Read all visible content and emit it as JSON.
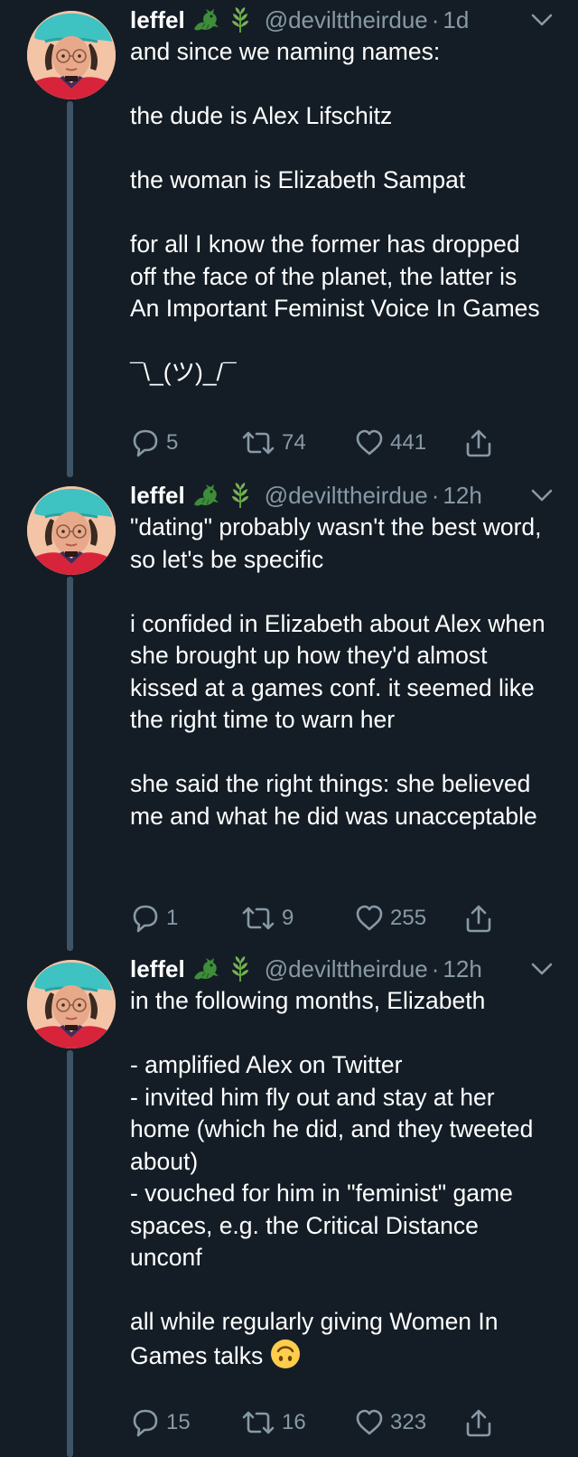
{
  "tweets": [
    {
      "name": "leffel",
      "handle": "@devilttheirdue",
      "time": "1d",
      "text": "and since we naming names:\n\nthe dude is Alex Lifschitz\n\nthe woman is Elizabeth Sampat\n\nfor all I know the former has dropped off the face of the planet, the latter is An Important Feminist Voice In Games\n\n¯\\_(ツ)_/¯",
      "replies": "5",
      "retweets": "74",
      "likes": "441"
    },
    {
      "name": "leffel",
      "handle": "@devilttheirdue",
      "time": "12h",
      "text": "\"dating\" probably wasn't the best word, so let's be specific\n\ni confided in Elizabeth about Alex when she brought up how they'd almost kissed at a games conf. it seemed like the right time to warn her\n\nshe said the right things: she believed me and what he did was unacceptable",
      "replies": "1",
      "retweets": "9",
      "likes": "255"
    },
    {
      "name": "leffel",
      "handle": "@devilttheirdue",
      "time": "12h",
      "text": "in the following months, Elizabeth\n\n- amplified Alex on Twitter\n- invited him fly out and stay at her home (which he did, and they tweeted about)\n- vouched for him in \"feminist\" game spaces, e.g. the Critical Distance unconf\n\nall while regularly giving Women In Games talks",
      "replies": "15",
      "retweets": "16",
      "likes": "323"
    }
  ],
  "separator": "·",
  "icons": {
    "name_emojis": [
      "dragon-icon",
      "herb-icon"
    ],
    "chevron": "chevron-down-icon",
    "reply": "reply-icon",
    "retweet": "retweet-icon",
    "like": "heart-icon",
    "share": "share-icon",
    "trailing_emoji": "upside-down-face-icon"
  },
  "colors": {
    "background": "#141d26",
    "text": "#ffffff",
    "secondary": "#8899a6",
    "thread_line": "#3d5466"
  }
}
